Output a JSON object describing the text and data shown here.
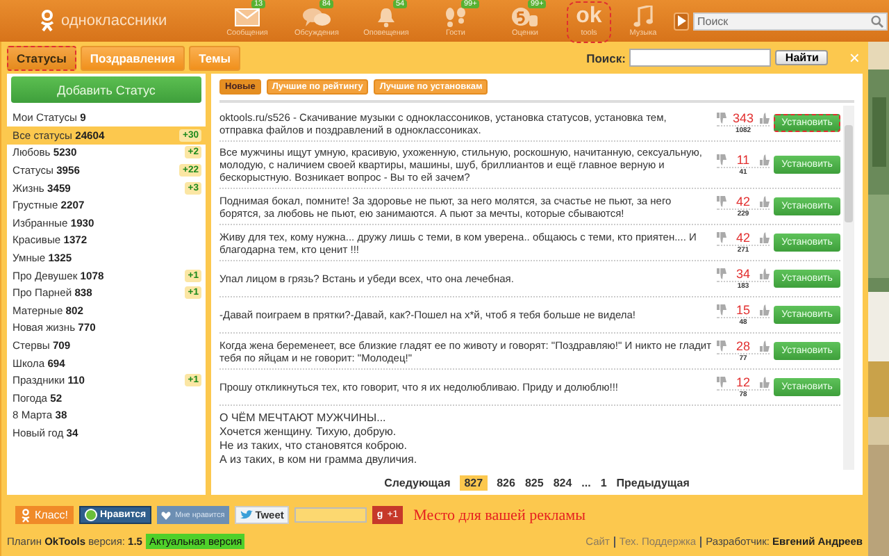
{
  "top_bar": {
    "logo": "одноклассники",
    "nav": [
      {
        "kind": "mail",
        "label": "Сообщения",
        "badge": "13"
      },
      {
        "kind": "chat",
        "label": "Обсуждения",
        "badge": "84"
      },
      {
        "kind": "bell",
        "label": "Оповещения",
        "badge": "54"
      },
      {
        "kind": "steps",
        "label": "Гости",
        "badge": "99+"
      },
      {
        "kind": "rating",
        "label": "Оценки",
        "badge": "99+"
      },
      {
        "kind": "ok",
        "mark": "ok",
        "label": "tools",
        "highlighted": true
      },
      {
        "kind": "music",
        "label": "Музыка"
      }
    ],
    "search": {
      "placeholder": "Поиск"
    }
  },
  "tabs": [
    {
      "label": "Статусы",
      "selected": true,
      "highlighted": true
    },
    {
      "label": "Поздравления",
      "selected": false,
      "highlighted": false
    },
    {
      "label": "Темы",
      "selected": false,
      "highlighted": false
    }
  ],
  "search": {
    "label": "Поиск:",
    "button": "Найти",
    "close": "×"
  },
  "sidebar": {
    "add_button": "Добавить Статус",
    "items": [
      {
        "name": "Мои Статусы",
        "count": "9",
        "selected": false
      },
      {
        "name": "Все статусы",
        "count": "24604",
        "badge": "+30",
        "selected": true
      },
      {
        "name": "Любовь",
        "count": "5230",
        "badge": "+2",
        "selected": false
      },
      {
        "name": "Статусы",
        "count": "3956",
        "badge": "+22",
        "selected": false
      },
      {
        "name": "Жизнь",
        "count": "3459",
        "badge": "+3",
        "selected": false
      },
      {
        "name": "Грустные",
        "count": "2207",
        "selected": false
      },
      {
        "name": "Избранные",
        "count": "1930",
        "selected": false
      },
      {
        "name": "Красивые",
        "count": "1372",
        "selected": false
      },
      {
        "name": "Умные",
        "count": "1325",
        "selected": false
      },
      {
        "name": "Про Девушек",
        "count": "1078",
        "badge": "+1",
        "selected": false
      },
      {
        "name": "Про Парней",
        "count": "838",
        "badge": "+1",
        "selected": false
      },
      {
        "name": "Матерные",
        "count": "802",
        "selected": false
      },
      {
        "name": "Новая жизнь",
        "count": "770",
        "selected": false
      },
      {
        "name": "Стервы",
        "count": "709",
        "selected": false
      },
      {
        "name": "Школа",
        "count": "694",
        "selected": false
      },
      {
        "name": "Праздники",
        "count": "110",
        "badge": "+1",
        "selected": false
      },
      {
        "name": "Погода",
        "count": "52",
        "selected": false
      },
      {
        "name": "8 Марта",
        "count": "38",
        "selected": false
      },
      {
        "name": "Новый год",
        "count": "34",
        "selected": false
      }
    ]
  },
  "filters": [
    {
      "label": "Новые",
      "selected": true
    },
    {
      "label": "Лучшие по рейтингу",
      "selected": false
    },
    {
      "label": "Лучшие по установкам",
      "selected": false
    }
  ],
  "statuses": [
    {
      "text": "oktools.ru/s526 - Скачивание музыки с одноклассоников, установка статусов, установка тем, отправка файлов и поздравлений в одноклассониках.",
      "score": "343",
      "installs": "1082",
      "button": "Установить",
      "highlighted": true
    },
    {
      "text": "Все мужчины ищут умную, красивую, ухоженную, стильную, роскошную, начитанную, сексуальную, молодую, с наличием своей квартиры, машины, шуб, бриллиантов и ещё главное верную и бескорыстную. Возникает вопрос - Вы то ей зачем?",
      "score": "11",
      "installs": "41",
      "button": "Установить",
      "highlighted": false
    },
    {
      "text": "Поднимая бокал, помните! За здоровье не пьют, за него молятся, за счастье не пьют, за него борятся, за любовь не пьют, ею занимаются. А пьют за мечты, которые сбываются!",
      "score": "42",
      "installs": "229",
      "button": "Установить",
      "highlighted": false
    },
    {
      "text": "Живу для тех, кому нужна... дружу лишь с теми, в ком уверена.. общаюсь с теми, кто приятен.... И благодарна тем, кто ценит !!!",
      "score": "42",
      "installs": "271",
      "button": "Установить",
      "highlighted": false
    },
    {
      "text": "Упал лицом в грязь? Встань и убеди всех, что она лечебная.",
      "score": "34",
      "installs": "183",
      "button": "Установить",
      "highlighted": false
    },
    {
      "text": "-Давай поиграем в прятки?-Давай, как?-Пошел на х*й, чтоб я тебя больше не видела!",
      "score": "15",
      "installs": "48",
      "button": "Установить",
      "highlighted": false
    },
    {
      "text": "Когда жена беременеет, все близкие гладят ее по животу и говорят: \"Поздравляю!\" И никто не гладит тебя по яйцам и не говорит: \"Молодец!\"",
      "score": "28",
      "installs": "77",
      "button": "Установить",
      "highlighted": false
    },
    {
      "text": "Прошу откликнуться тех, кто говорит, что я их недолюбливаю. Приду и долюблю!!!",
      "score": "12",
      "installs": "78",
      "button": "Установить",
      "highlighted": false
    }
  ],
  "poem": [
    "О ЧЁМ МЕЧТАЮТ МУЖЧИНЫ...",
    "Хочется женщину. Тихую, добрую.",
    "Не из таких, что становятся коброю.",
    "А из таких, в ком ни грамма двуличия."
  ],
  "pagination": [
    {
      "label": "Следующая",
      "selected": false
    },
    {
      "label": "827",
      "selected": true
    },
    {
      "label": "826",
      "selected": false
    },
    {
      "label": "825",
      "selected": false
    },
    {
      "label": "824",
      "selected": false
    },
    {
      "label": "...",
      "selected": false
    },
    {
      "label": "1",
      "selected": false
    },
    {
      "label": "Предыдущая",
      "selected": false
    }
  ],
  "social": {
    "klass": "Класс!",
    "like": "Нравится",
    "vk": "Мне нравится",
    "tweet": "Tweet",
    "gplus_icon": "g",
    "gplus": "+1",
    "ad": "Место для вашей рекламы"
  },
  "footer": {
    "version": "Плагин **OkTools** версия: **1.5**",
    "badge": "Актуальная версия",
    "links": [
      "Сайт",
      "Тех. Поддержка"
    ],
    "developer": "Разработчик: **Евгений Андреев**"
  }
}
